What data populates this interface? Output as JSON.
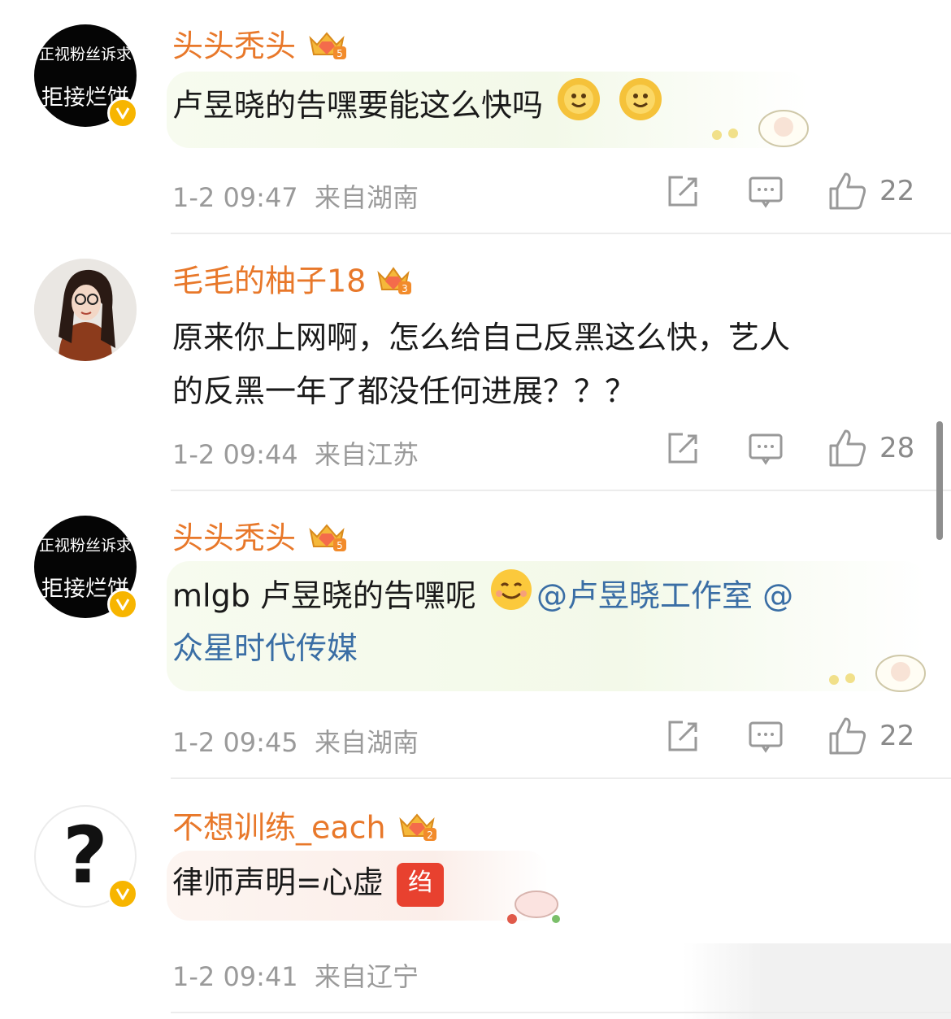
{
  "comments": [
    {
      "avatar_line1": "正视粉丝诉求",
      "avatar_line2": "拒接烂饼",
      "username": "头头秃头",
      "text": "卢昱晓的告嘿要能这么快吗",
      "time": "1-2 09:47",
      "location": "来自湖南",
      "likes": "22",
      "level": "5"
    },
    {
      "username": "毛毛的柚子18",
      "text_line1": "原来你上网啊，怎么给自己反黑这么快，艺人",
      "text_line2": "的反黑一年了都没任何进展？？？",
      "time": "1-2 09:44",
      "location": "来自江苏",
      "likes": "28",
      "level": "3"
    },
    {
      "avatar_line1": "正视粉丝诉求",
      "avatar_line2": "拒接烂饼",
      "username": "头头秃头",
      "text_prefix": "mlgb 卢昱晓的告嘿呢",
      "mention1": "@卢昱晓工作室",
      "mention2_part1": "@",
      "mention2_part2": "众星时代传媒",
      "time": "1-2 09:45",
      "location": "来自湖南",
      "likes": "22",
      "level": "5"
    },
    {
      "avatar_symbol": "?",
      "username": "不想训练_each",
      "text": "律师声明=心虚",
      "sticker_text": "绉",
      "time": "1-2 09:41",
      "location": "来自辽宁",
      "level": "2"
    }
  ],
  "colors": {
    "username": "#e8782a",
    "link": "#3a6ea5",
    "meta": "#9a9a9a",
    "verified": "#f7b500"
  }
}
